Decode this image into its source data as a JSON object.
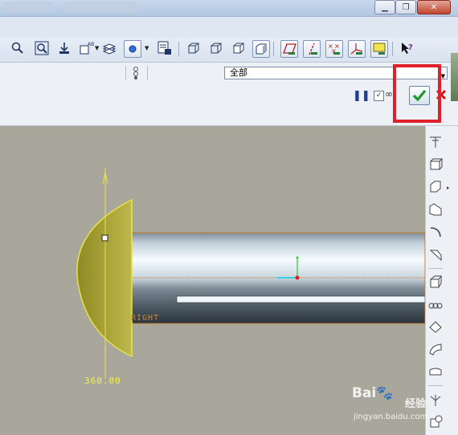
{
  "toolbar": {
    "items": [
      "zoom-in",
      "zoom-area",
      "refit",
      "reorient",
      "saved-views",
      "layers",
      "display-style",
      "view-manager",
      "wireframe",
      "hidden-line",
      "no-hidden",
      "shading",
      "datum-planes",
      "datum-axes",
      "datum-points",
      "coordinate-systems",
      "annotation",
      "whats-this"
    ]
  },
  "filter": {
    "selected": "全部"
  },
  "dashboard": {
    "ok_label": "✔",
    "cancel_label": "✖"
  },
  "sketch": {
    "angle_dimension": "360.00",
    "datum_label": "RIGHT"
  },
  "colors": {
    "revolve_fill": "#b2ac3b",
    "highlight_box": "#e0202a",
    "dimension_text": "#f3f14a"
  },
  "watermark": {
    "brand": "Bai",
    "cn": "经验",
    "url": "jingyan.baidu.com"
  }
}
